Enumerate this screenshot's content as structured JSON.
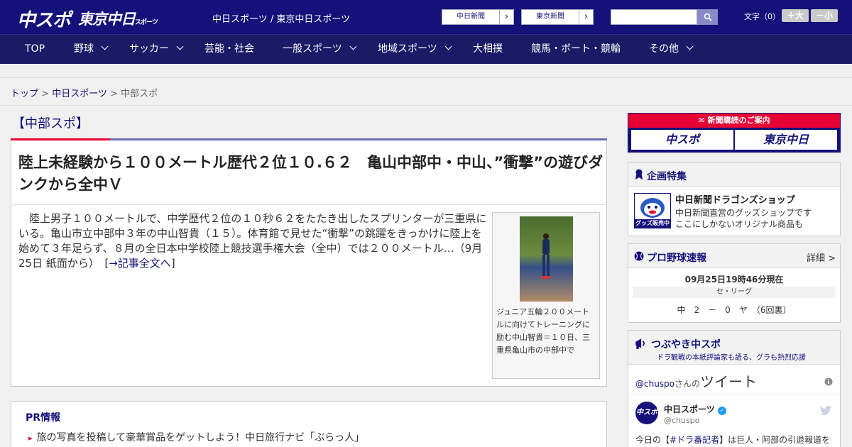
{
  "header": {
    "logo_chuspo": "中スポ",
    "logo_tokyo": "東京中日",
    "logo_tokyo_sub": "スポーツ",
    "site_title": "中日スポーツ / 東京中日スポーツ",
    "ext_links": [
      "中日新聞",
      "東京新聞"
    ],
    "font_label": "文字（0）",
    "font_larger": "＋大",
    "font_smaller": "－小"
  },
  "nav": {
    "items": [
      {
        "label": "TOP",
        "dropdown": false
      },
      {
        "label": "野球",
        "dropdown": true
      },
      {
        "label": "サッカー",
        "dropdown": true
      },
      {
        "label": "芸能・社会",
        "dropdown": false
      },
      {
        "label": "一般スポーツ",
        "dropdown": true
      },
      {
        "label": "地域スポーツ",
        "dropdown": true
      },
      {
        "label": "大相撲",
        "dropdown": false
      },
      {
        "label": "競馬・ボート・競輪",
        "dropdown": false
      },
      {
        "label": "その他",
        "dropdown": true
      }
    ]
  },
  "breadcrumb": {
    "top": "トップ",
    "sep": ">",
    "parent": "中日スポーツ",
    "current": "中部スポ"
  },
  "section": {
    "title": "【中部スポ】"
  },
  "article": {
    "title": "陸上未経験から１００メートル歴代２位１０.６２　亀山中部中・中山、”衝撃”の遊びダンクから全中Ｖ",
    "body": "陸上男子１００メートルで、中学歴代２位の１０秒６２をたたき出したスプリンターが三重県にいる。亀山市立中部中３年の中山智貴（１５）。体育館で見せた“衝撃”の跳躍をきっかけに陸上を始めて３年足らず、８月の全日本中学校陸上競技選手権大会（全中）では２００メートル…（9月25日 紙面から）",
    "more_prefix": "[",
    "more_link": "→記事全文へ",
    "more_suffix": "]",
    "photo_caption": "ジュニア五輪２００メートルに向けてトレーニングに励む中山智貴＝１０日、三重県亀山市の中部中で"
  },
  "pr": {
    "title": "PR情報",
    "items": [
      "旅の写真を投稿して豪華賞品をゲットしよう！中日旅行ナビ「ぶらっ人」",
      ""
    ]
  },
  "subscribe": {
    "head": "新聞購読のご案内",
    "buttons": [
      "中スポ",
      "東京中日"
    ]
  },
  "feature": {
    "title": "企画特集",
    "shop_title": "中日新聞ドラゴンズショップ",
    "shop_desc_1": "中日新聞直営のグッズショップです",
    "shop_desc_2": "ここにしかないオリジナル商品も",
    "shop_logo_text": "グッズ販売中"
  },
  "baseball": {
    "title": "プロ野球速報",
    "more": "詳細 >",
    "timestamp": "09月25日19時46分現在",
    "league": "セ・リーグ",
    "score_line": "中　2　－　0　ヤ　（6回裏）"
  },
  "tweets": {
    "title": "つぶやき中スポ",
    "subtitle": "ドラ観戦の本紙評論家も語る、グラも熱烈応援",
    "handle": "@chuspo",
    "handle_suffix": "さんの",
    "heading": "ツイート",
    "name": "中日スポーツ",
    "user": "@chuspo",
    "avatar_text": "中スポ",
    "text_prefix": "今日の【",
    "text_tag": "#ドラ番記者",
    "text_suffix": "】は巨人・阿部の引退報道を"
  },
  "colors": {
    "brand_navy": "#14117a",
    "accent_red": "#e60033"
  }
}
